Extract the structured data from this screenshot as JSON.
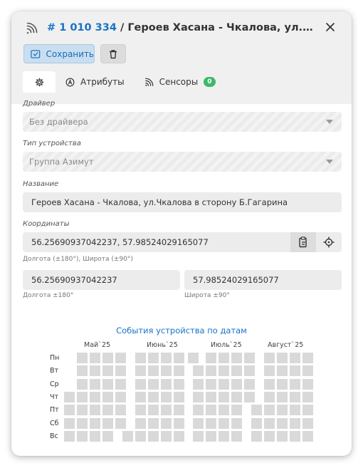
{
  "header": {
    "id_text": "# 1 010 334",
    "title_rest": " / Героев Хасана - Чкалова, ул.Чкалова в сторону Б.Гагарина",
    "save_label": "Сохранить"
  },
  "tabs": [
    {
      "label": "",
      "icon": "gear-icon"
    },
    {
      "label": "Атрибуты",
      "icon": "attributes-icon"
    },
    {
      "label": "Сенсоры",
      "icon": "sensor-icon",
      "badge": "0"
    }
  ],
  "form": {
    "driver": {
      "label": "Драйвер",
      "value": "Без драйвера"
    },
    "device_type": {
      "label": "Тип устройства",
      "value": "Группа Азимут"
    },
    "name": {
      "label": "Название",
      "value": "Героев Хасана - Чкалова, ул.Чкалова в сторону Б.Гагарина"
    },
    "coords": {
      "label": "Координаты",
      "value": "56.25690937042237, 57.98524029165077",
      "hint": "Долгота (±180°), Широта (±90°)",
      "lon_value": "56.25690937042237",
      "lat_value": "57.98524029165077",
      "lon_hint": "Долгота ±180°",
      "lat_hint": "Широта ±90°"
    }
  },
  "chart_data": {
    "type": "heatmap",
    "title": "События устройства по датам",
    "months": [
      "Май`25",
      "Июнь`25",
      "Июль`25",
      "Август`25"
    ],
    "days": [
      "Пн",
      "Вт",
      "Ср",
      "Чт",
      "Пт",
      "Сб",
      "Вс"
    ],
    "weeks": 20,
    "colors": {
      "empty": "#d9d9d9"
    }
  }
}
